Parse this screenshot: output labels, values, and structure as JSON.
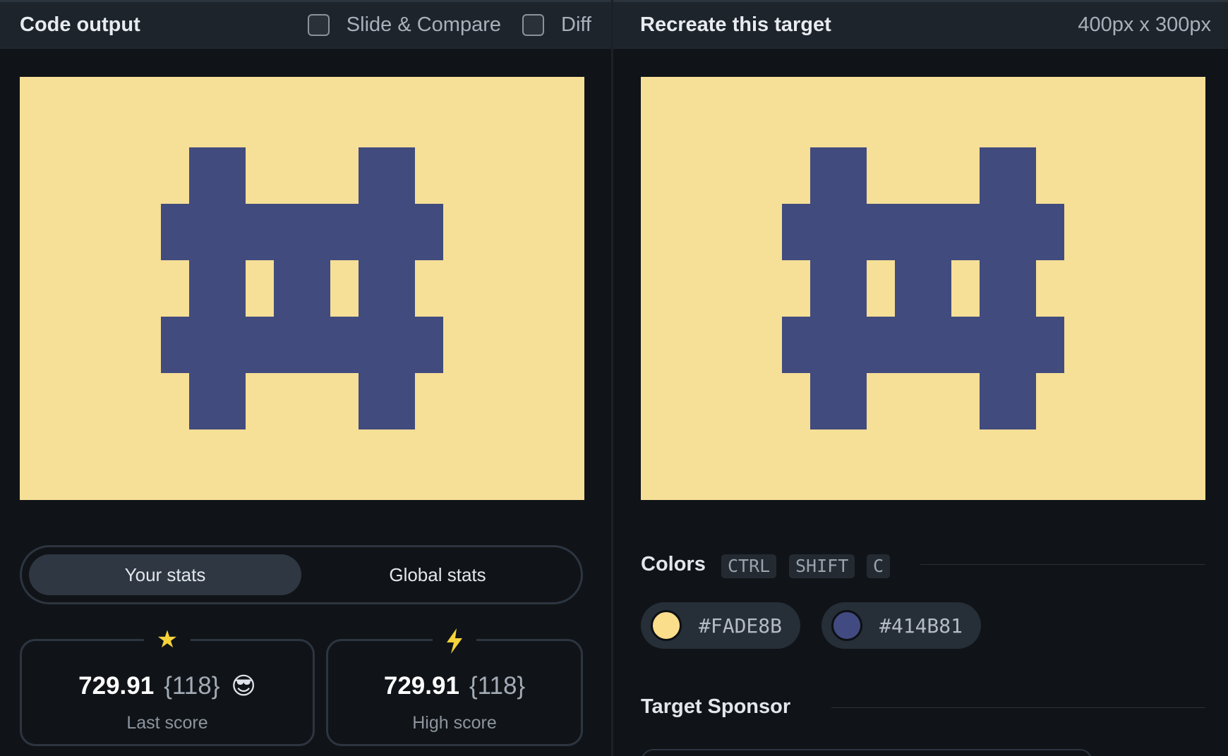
{
  "header_left": {
    "title": "Code output",
    "slide_compare_label": "Slide & Compare",
    "diff_label": "Diff"
  },
  "header_right": {
    "title": "Recreate this target",
    "dimensions": "400px x 300px"
  },
  "canvas": {
    "background": "#FADE8B",
    "foreground": "#414B81"
  },
  "stats_tabs": [
    "Your stats",
    "Global stats"
  ],
  "stats": {
    "last": {
      "score": "729.91",
      "count": "{118}",
      "emoji": "😎",
      "label": "Last score",
      "icon": "star-icon"
    },
    "high": {
      "score": "729.91",
      "count": "{118}",
      "label": "High score",
      "icon": "lightning-icon"
    }
  },
  "colors": {
    "title": "Colors",
    "shortcut": [
      "CTRL",
      "SHIFT",
      "C"
    ],
    "items": [
      {
        "hex": "#FADE8B"
      },
      {
        "hex": "#414B81"
      }
    ]
  },
  "sponsor": {
    "title": "Target Sponsor"
  }
}
